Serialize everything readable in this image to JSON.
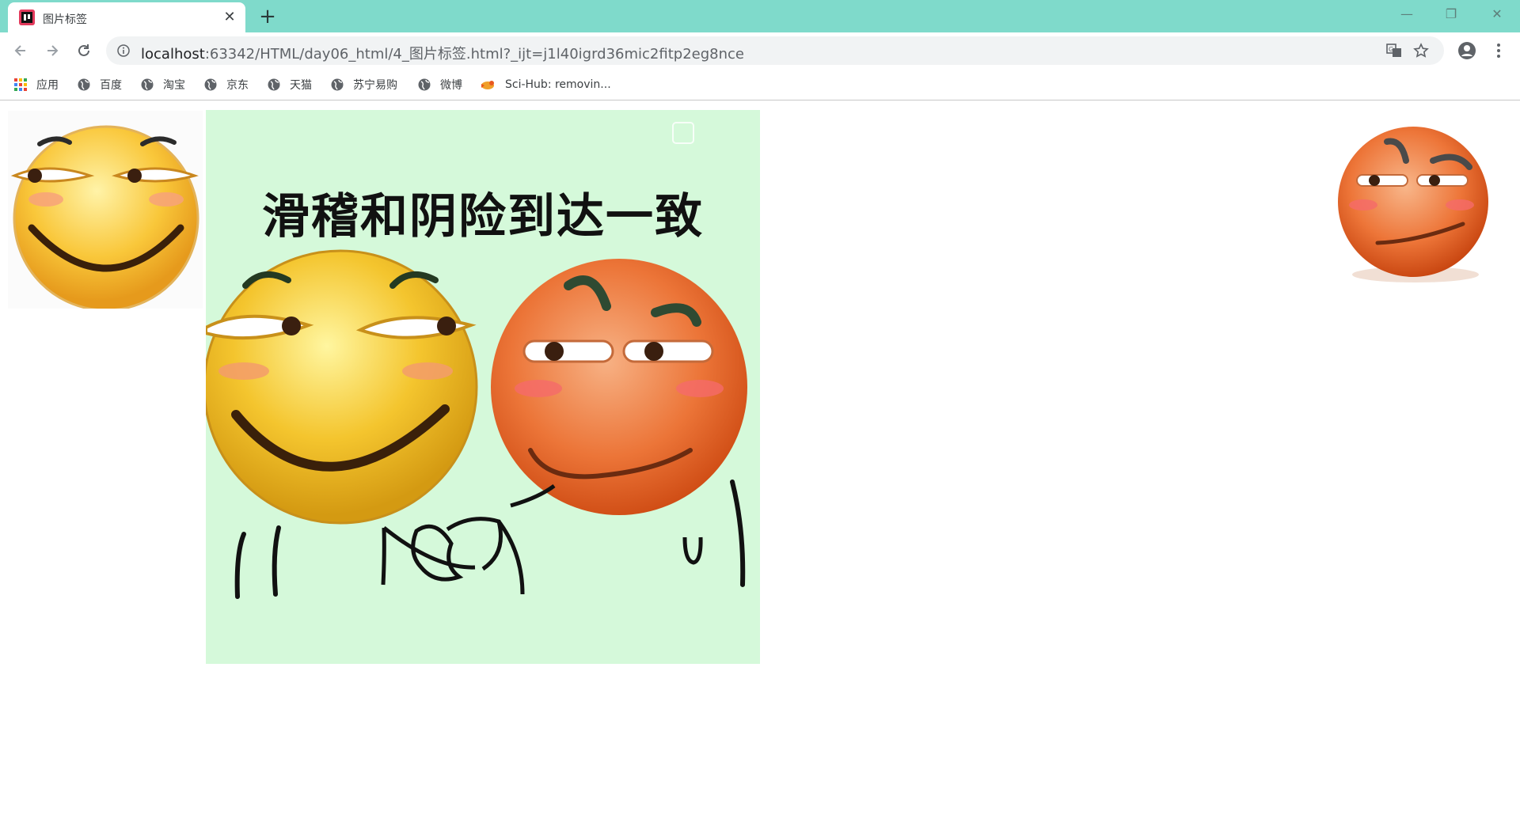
{
  "browser": {
    "tab": {
      "title": "图片标签",
      "close": "✕"
    },
    "new_tab": "+",
    "window_controls": {
      "minimize": "—",
      "restore": "❐",
      "close": "✕"
    },
    "address": {
      "host": "localhost",
      "rest": ":63342/HTML/day06_html/4_图片标签.html?_ijt=j1l40igrd36mic2fitp2eg8nce"
    },
    "bookmarks": [
      {
        "label": "应用",
        "icon": "apps-grid-icon"
      },
      {
        "label": "百度",
        "icon": "globe-icon"
      },
      {
        "label": "淘宝",
        "icon": "globe-icon"
      },
      {
        "label": "京东",
        "icon": "globe-icon"
      },
      {
        "label": "天猫",
        "icon": "globe-icon"
      },
      {
        "label": "苏宁易购",
        "icon": "globe-icon"
      },
      {
        "label": "微博",
        "icon": "globe-icon"
      },
      {
        "label": "Sci-Hub: removin...",
        "icon": "bird-icon"
      }
    ]
  },
  "page": {
    "meme_caption": "滑稽和阴险到达一致"
  },
  "colors": {
    "tabstrip": "#7fdacb",
    "meme_bg": "#d5f9da",
    "yellow_face": "#f5c32c",
    "orange_face": "#ee7a3e"
  }
}
